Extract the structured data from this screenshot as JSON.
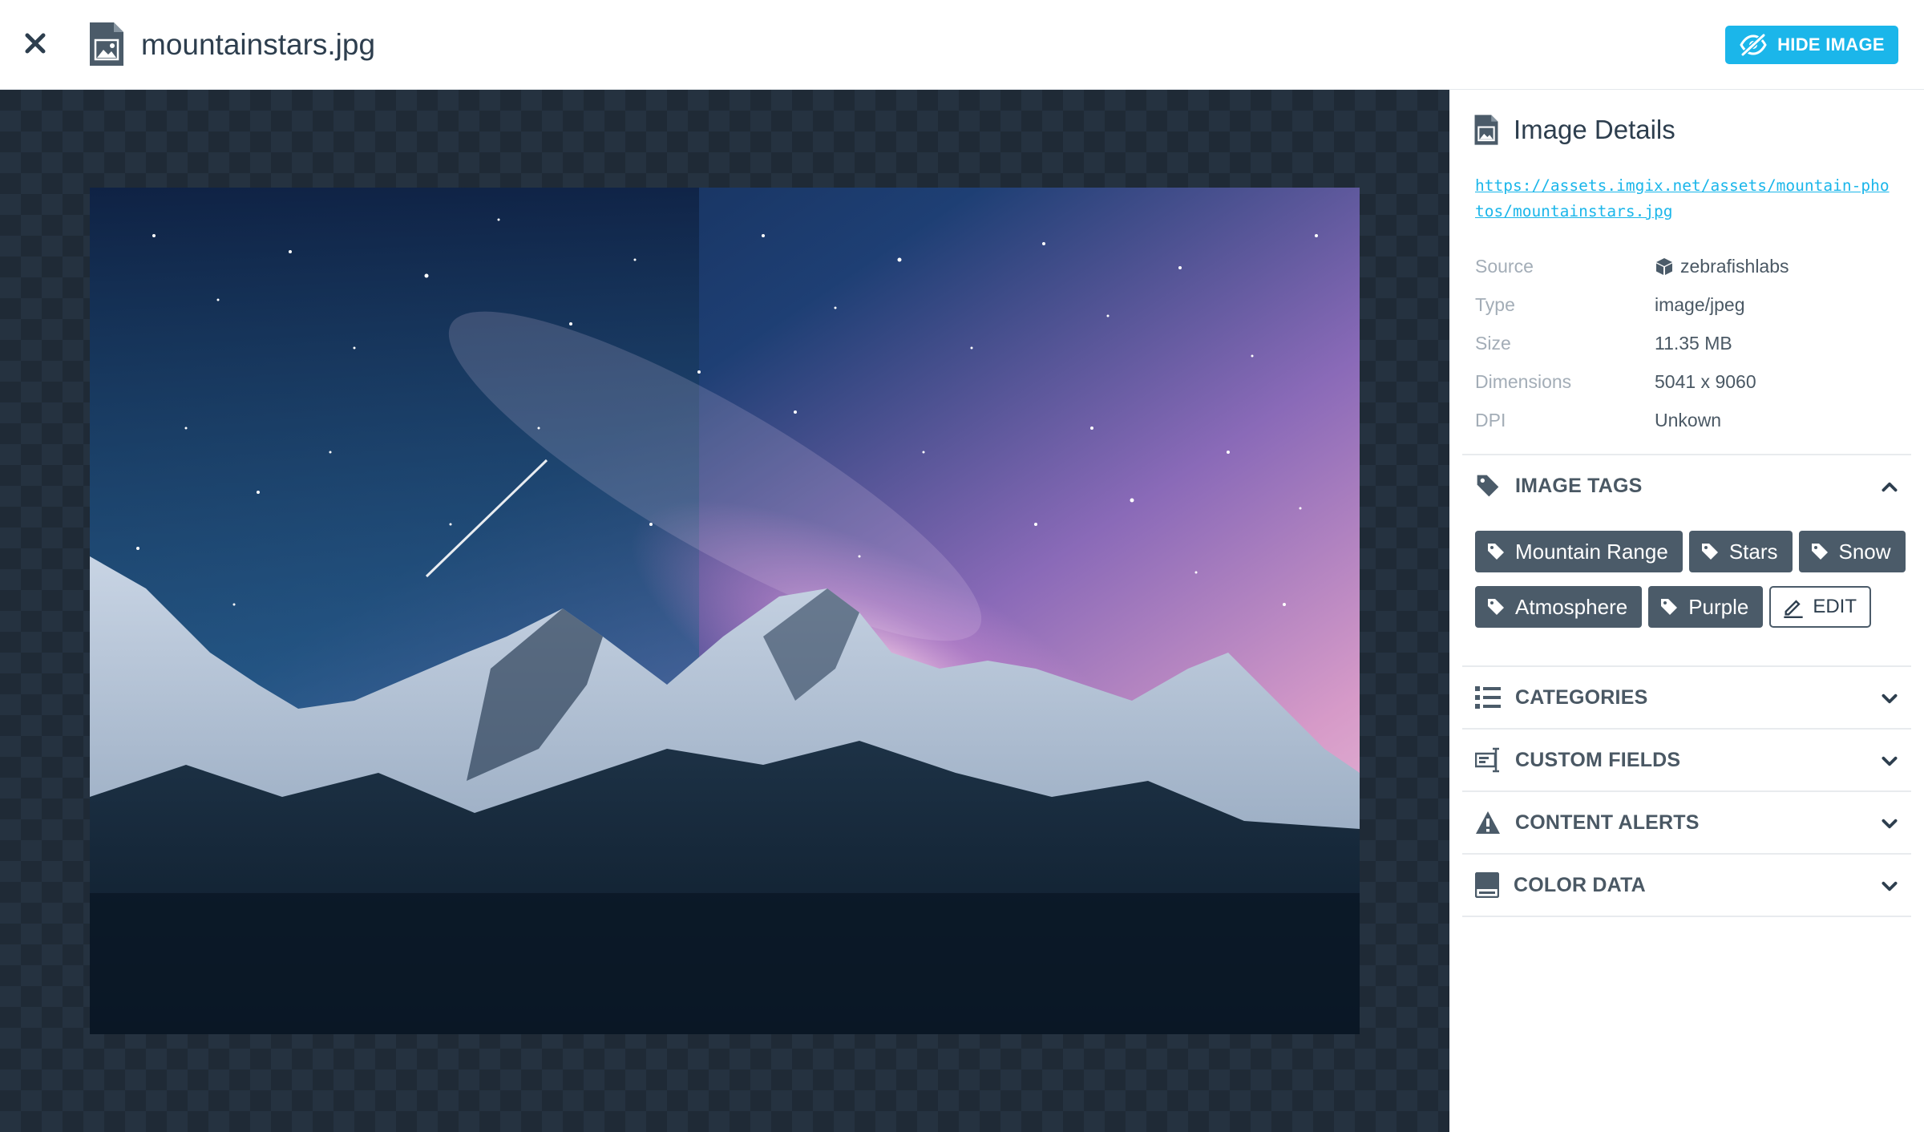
{
  "header": {
    "file_name": "mountainstars.jpg",
    "hide_button_label": "HIDE IMAGE"
  },
  "details": {
    "title": "Image Details",
    "url": "https://assets.imgix.net/assets/mountain-photos/mountainstars.jpg",
    "fields": [
      {
        "label": "Source",
        "value": "zebrafishlabs"
      },
      {
        "label": "Type",
        "value": "image/jpeg"
      },
      {
        "label": "Size",
        "value": "11.35 MB"
      },
      {
        "label": "Dimensions",
        "value": "5041 x 9060"
      },
      {
        "label": "DPI",
        "value": "Unkown"
      }
    ]
  },
  "tags_section": {
    "title": "IMAGE TAGS",
    "tags": [
      "Mountain Range",
      "Stars",
      "Snow",
      "Atmosphere",
      "Purple"
    ],
    "edit_label": "EDIT"
  },
  "sections": {
    "categories": "CATEGORIES",
    "custom_fields": "CUSTOM FIELDS",
    "content_alerts": "CONTENT ALERTS",
    "color_data": "COLOR DATA"
  },
  "colors": {
    "accent": "#1bb6ea",
    "tag_bg": "#4b5b69",
    "text": "#2d3e4e",
    "viewer_bg": "#1f2a36"
  },
  "icons": {
    "close": "close-icon",
    "file": "file-image-icon",
    "hide": "eye-slash-icon",
    "source": "cube-icon",
    "tag": "tag-icon",
    "edit": "pencil-icon",
    "categories": "list-icon",
    "custom_fields": "custom-fields-icon",
    "content_alerts": "warning-icon",
    "color_data": "color-swatch-icon",
    "chevron_up": "chevron-up-icon",
    "chevron_down": "chevron-down-icon"
  }
}
